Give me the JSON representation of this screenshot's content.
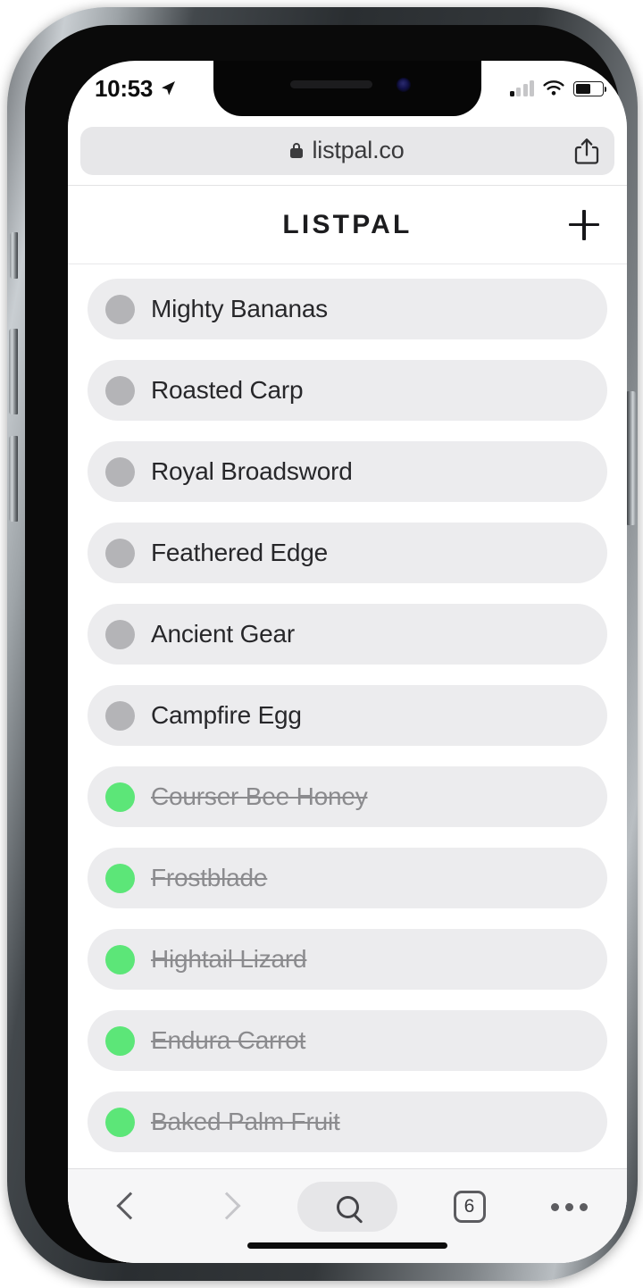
{
  "status_bar": {
    "time": "10:53",
    "location_icon": "location-arrow-icon",
    "signal_icon": "cellular-signal-icon",
    "wifi_icon": "wifi-icon",
    "battery_icon": "battery-icon"
  },
  "browser": {
    "url": "listpal.co",
    "lock_icon": "lock-icon",
    "share_icon": "share-icon",
    "toolbar": {
      "back_icon": "chevron-left-icon",
      "forward_icon": "chevron-right-icon",
      "search_icon": "search-icon",
      "tabs_count": "6",
      "more_icon": "ellipsis-icon"
    }
  },
  "app": {
    "title": "LISTPAL",
    "add_button_icon": "plus-icon",
    "accent_done_color": "#5ce678",
    "dot_pending_color": "#b4b4b7",
    "row_bg_color": "#ececee",
    "items": [
      {
        "label": "Mighty Bananas",
        "done": false
      },
      {
        "label": "Roasted Carp",
        "done": false
      },
      {
        "label": "Royal Broadsword",
        "done": false
      },
      {
        "label": "Feathered Edge",
        "done": false
      },
      {
        "label": "Ancient Gear",
        "done": false
      },
      {
        "label": "Campfire Egg",
        "done": false
      },
      {
        "label": "Courser Bee Honey",
        "done": true
      },
      {
        "label": "Frostblade",
        "done": true
      },
      {
        "label": "Hightail Lizard",
        "done": true
      },
      {
        "label": "Endura Carrot",
        "done": true
      },
      {
        "label": "Baked Palm Fruit",
        "done": true
      }
    ]
  }
}
